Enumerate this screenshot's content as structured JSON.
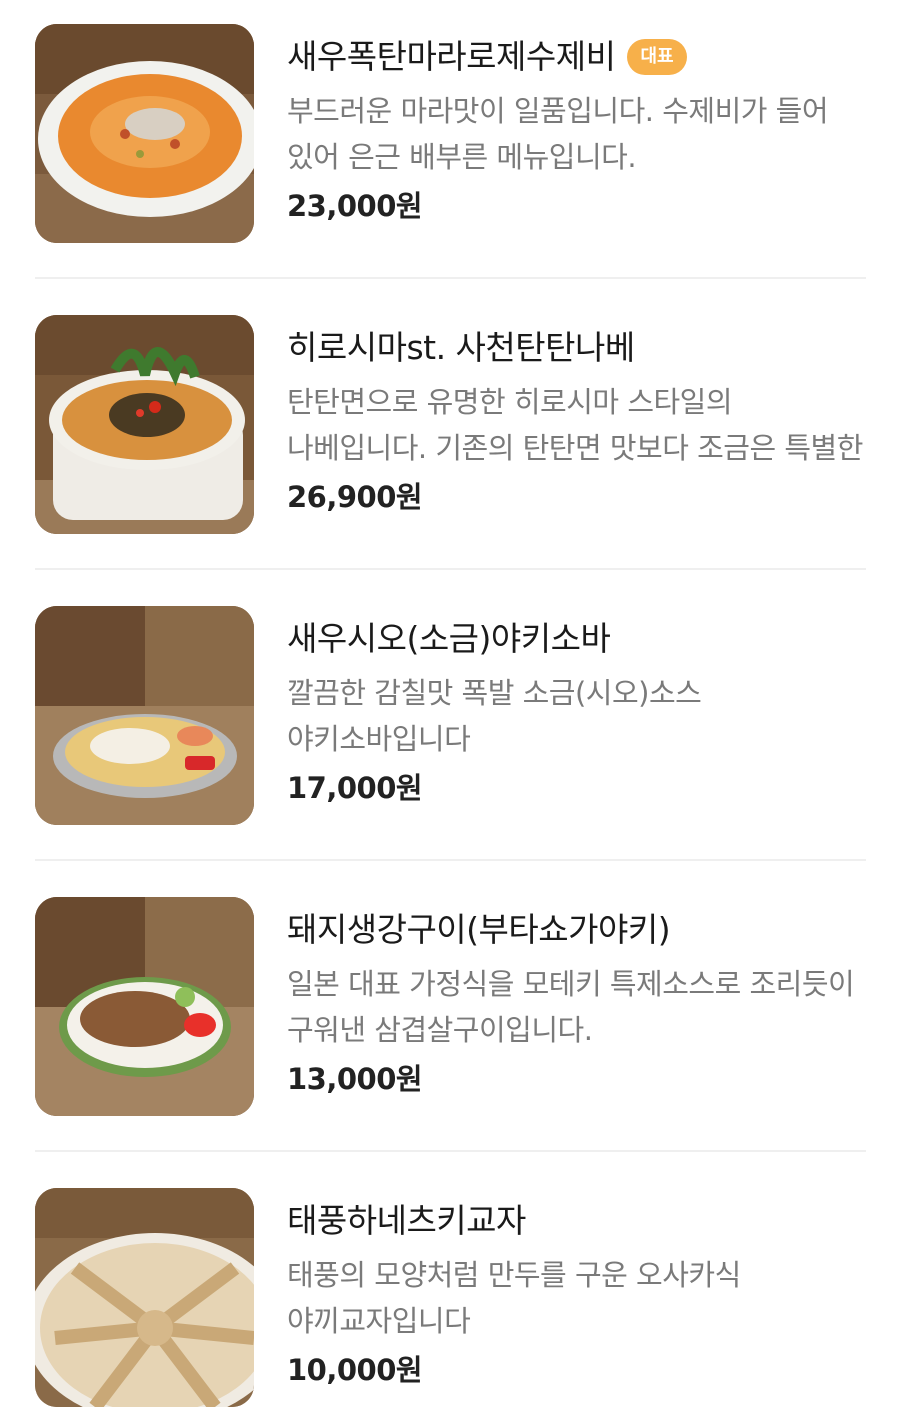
{
  "menu": {
    "items": [
      {
        "name": "새우폭탄마라로제수제비",
        "badge": "대표",
        "description": "부드러운 마라맛이 일품입니다. 수제비가 들어 있어 은근 배부른 메뉴입니다.",
        "price": "23,000원",
        "image_icon": "rose-sujebi-photo"
      },
      {
        "name": "히로시마st. 사천탄탄나베",
        "description": "탄탄면으로 유명한 히로시마 스타일의 나베입니다. 기존의 탄탄면 맛보다 조금은 특별한 맛",
        "price": "26,900원",
        "image_icon": "tantan-nabe-photo"
      },
      {
        "name": "새우시오(소금)야키소바",
        "description": "깔끔한 감칠맛 폭발 소금(시오)소스 야키소바입니다",
        "price": "17,000원",
        "image_icon": "yakisoba-photo"
      },
      {
        "name": "돼지생강구이(부타쇼가야키)",
        "description": "일본 대표 가정식을 모테키 특제소스로 조리듯이 구워낸 삼겹살구이입니다.",
        "price": "13,000원",
        "image_icon": "pork-ginger-photo"
      },
      {
        "name": "태풍하네츠키교자",
        "description": "태풍의 모양처럼 만두를 구운 오사카식 야끼교자입니다",
        "price": "10,000원",
        "image_icon": "gyoza-photo"
      }
    ]
  }
}
